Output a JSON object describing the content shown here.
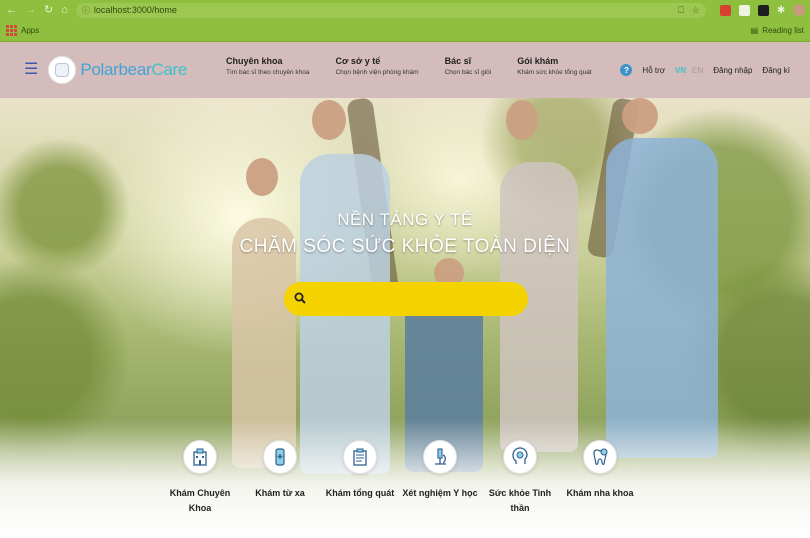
{
  "browser": {
    "url": "localhost:3000/home",
    "bookmarks_apps": "Apps",
    "reading_list": "Reading list"
  },
  "header": {
    "logo_part1": "Polarbear",
    "logo_part2": "Care",
    "menu": [
      {
        "title": "Chuyên khoa",
        "subtitle": "Tìm bác sĩ theo chuyên khoa"
      },
      {
        "title": "Cơ sở y tế",
        "subtitle": "Chọn bệnh viện phòng khám"
      },
      {
        "title": "Bác sĩ",
        "subtitle": "Chọn bác sĩ giỏi"
      },
      {
        "title": "Gói khám",
        "subtitle": "Khám sức khỏe tổng quát"
      }
    ],
    "help_label": "Hỗ trợ",
    "lang_vn": "VN",
    "lang_en": "EN",
    "login": "Đăng nhập",
    "register": "Đăng kí"
  },
  "hero": {
    "title_line1": "NỀN TẢNG Y TẾ",
    "title_line2": "CHĂM SÓC SỨC KHỎE TOÀN DIỆN",
    "search_placeholder": ""
  },
  "services": [
    {
      "label": "Khám Chuyên Khoa",
      "icon": "hospital-icon"
    },
    {
      "label": "Khám từ xa",
      "icon": "phone-medical-icon"
    },
    {
      "label": "Khám tổng quát",
      "icon": "clipboard-icon"
    },
    {
      "label": "Xét nghiệm Y học",
      "icon": "microscope-icon"
    },
    {
      "label": "Sức khỏe Tinh thần",
      "icon": "mental-health-icon"
    },
    {
      "label": "Khám nha khoa",
      "icon": "tooth-icon"
    }
  ],
  "colors": {
    "chrome": "#8fbf3f",
    "header_bg": "#d4bcbc",
    "search_bg": "#f5d300",
    "logo_blue": "#44a3d8",
    "logo_teal": "#3fc1c9"
  }
}
